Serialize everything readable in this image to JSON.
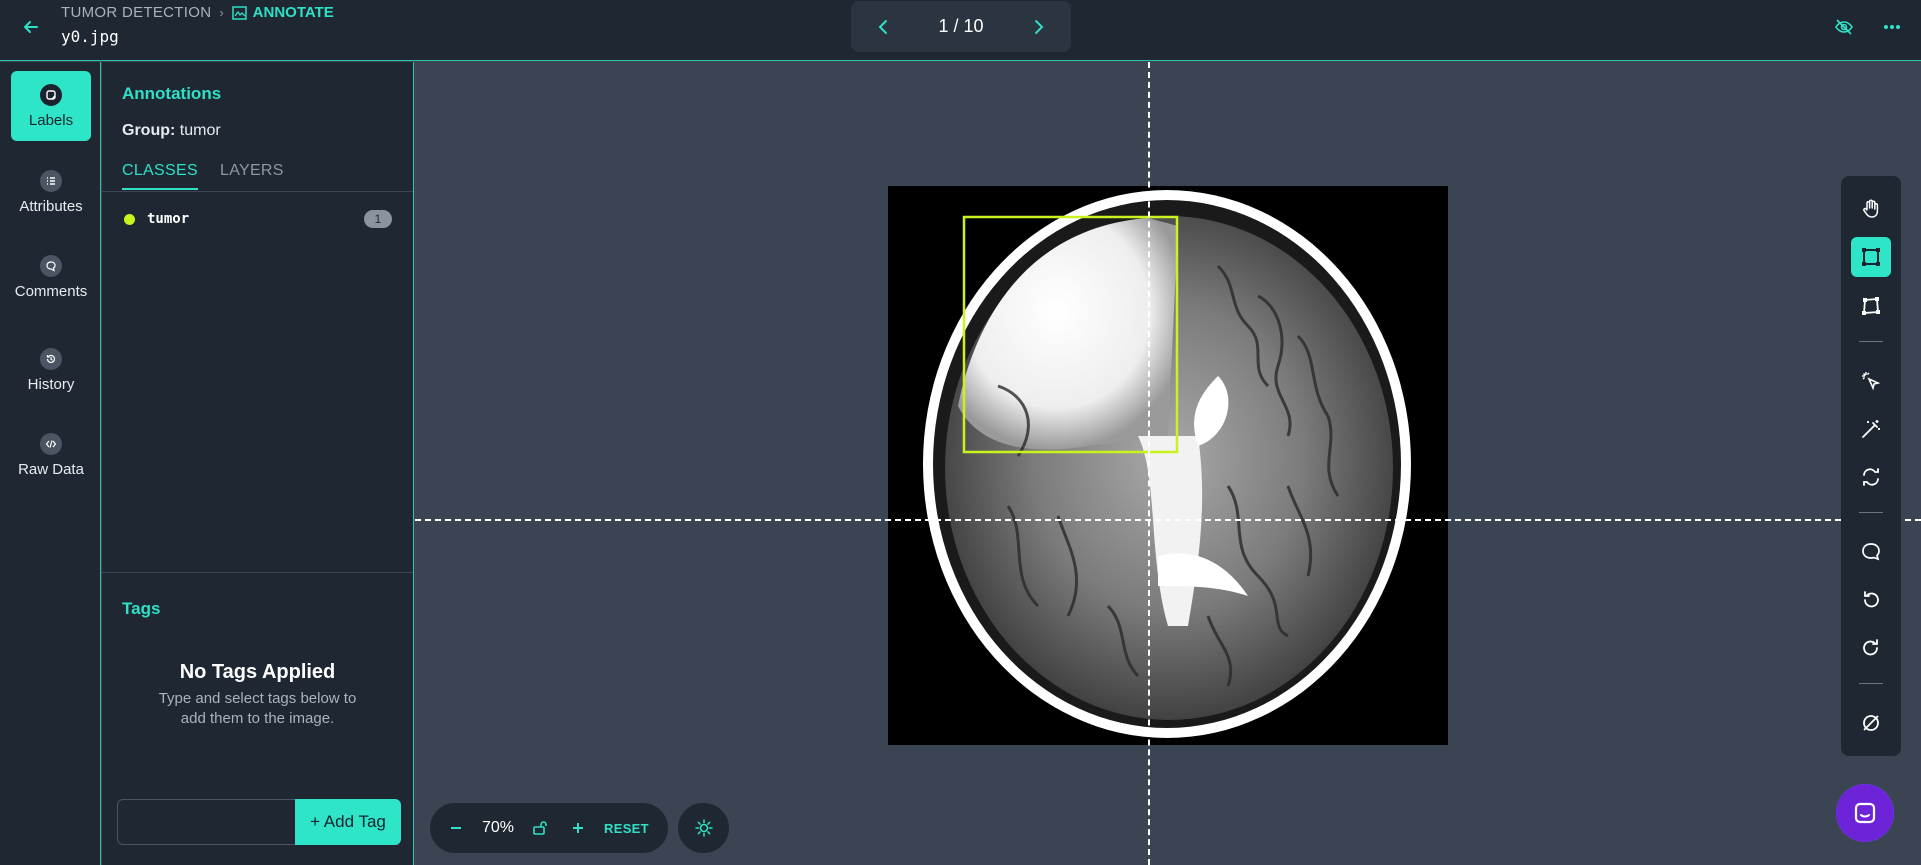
{
  "header": {
    "breadcrumb_project": "TUMOR DETECTION",
    "breadcrumb_separator": "›",
    "breadcrumb_mode": "ANNOTATE",
    "filename": "y0.jpg",
    "pager": "1 / 10"
  },
  "rail": {
    "items": [
      {
        "label": "Labels",
        "icon": "label-icon",
        "active": true
      },
      {
        "label": "Attributes",
        "icon": "list-icon",
        "active": false
      },
      {
        "label": "Comments",
        "icon": "comment-icon",
        "active": false
      },
      {
        "label": "History",
        "icon": "history-icon",
        "active": false
      },
      {
        "label": "Raw Data",
        "icon": "code-icon",
        "active": false
      }
    ]
  },
  "panel": {
    "title": "Annotations",
    "group_label": "Group:",
    "group_value": "tumor",
    "tabs": [
      {
        "label": "CLASSES",
        "active": true
      },
      {
        "label": "LAYERS",
        "active": false
      }
    ],
    "classes": [
      {
        "name": "tumor",
        "count": "1",
        "color": "#c8f31c"
      }
    ]
  },
  "tags": {
    "title": "Tags",
    "empty_title": "No Tags Applied",
    "empty_text": "Type and select tags below to add them to the image.",
    "input_value": "",
    "add_button": "+ Add Tag"
  },
  "zoom": {
    "level": "70%",
    "reset": "RESET"
  },
  "colors": {
    "accent": "#2ee6c7",
    "bounding_box": "#c8f31c",
    "panel_bg": "#1f2732",
    "canvas_bg": "#3b4453"
  }
}
